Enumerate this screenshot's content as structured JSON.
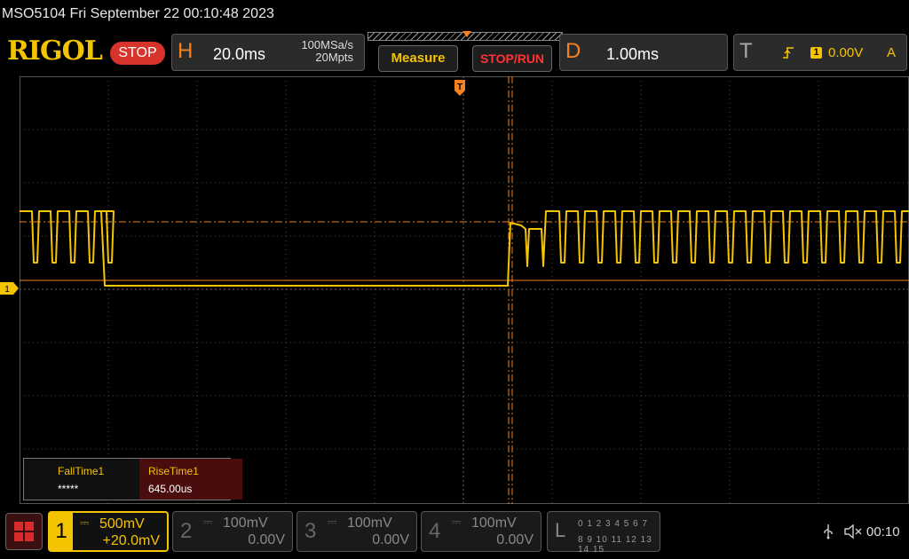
{
  "window": {
    "title": "MSO5104  Fri September 22 00:10:48 2023"
  },
  "brand": {
    "logo": "RIGOL",
    "run_state": "STOP"
  },
  "horizontal": {
    "letter": "H",
    "timebase": "20.0ms",
    "sample_rate": "100MSa/s",
    "memory_depth": "20Mpts"
  },
  "buttons": {
    "measure": "Measure",
    "stop_run": "STOP/RUN"
  },
  "delay": {
    "letter": "D",
    "value": "1.00ms"
  },
  "trigger": {
    "letter": "T",
    "edge_icon": "rising-edge-icon",
    "source": "1",
    "level": "0.00V",
    "mode": "A"
  },
  "markers": {
    "channel1": "1",
    "trigger": "T"
  },
  "measurements": [
    {
      "name": "FallTime1",
      "value": "*****"
    },
    {
      "name": "RiseTime1",
      "value": "645.00us"
    }
  ],
  "channels": [
    {
      "num": "1",
      "scale": "500mV",
      "offset": "+20.0mV",
      "active": true
    },
    {
      "num": "2",
      "scale": "100mV",
      "offset": "0.00V",
      "active": false
    },
    {
      "num": "3",
      "scale": "100mV",
      "offset": "0.00V",
      "active": false
    },
    {
      "num": "4",
      "scale": "100mV",
      "offset": "0.00V",
      "active": false
    }
  ],
  "logic": {
    "letter": "L",
    "row1": "0 1 2 3  4 5 6 7",
    "row2": "8 9 10 11 12 13 14 15"
  },
  "status": {
    "time": "00:10"
  },
  "colors": {
    "ch1": "#f5c400",
    "accent": "#f5821f",
    "stop": "#d9342b"
  }
}
